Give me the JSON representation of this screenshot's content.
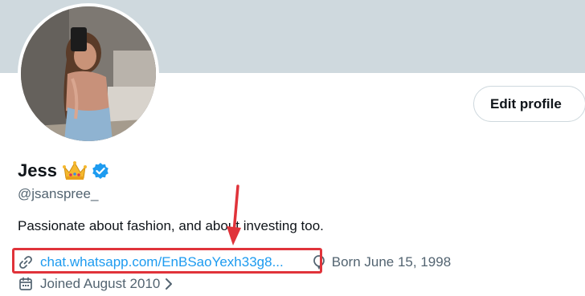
{
  "profile": {
    "name": "Jess",
    "handle": "@jsanspree_",
    "bio": "Passionate about fashion, and about investing too.",
    "link": "chat.whatsapp.com/EnBSaoYexh33g8...",
    "born": "Born June 15, 1998",
    "joined": "Joined August 2010"
  },
  "actions": {
    "edit_profile": "Edit profile"
  },
  "icons": {
    "crown": "crown-emoji",
    "verified": "verified-badge-icon",
    "link": "link-icon",
    "born": "balloon-icon",
    "joined": "calendar-icon",
    "chevron": "chevron-right-icon"
  },
  "colors": {
    "banner": "#cfd9de",
    "link": "#1d9bf0",
    "secondary_text": "#536471",
    "annotation": "#e0333a"
  }
}
